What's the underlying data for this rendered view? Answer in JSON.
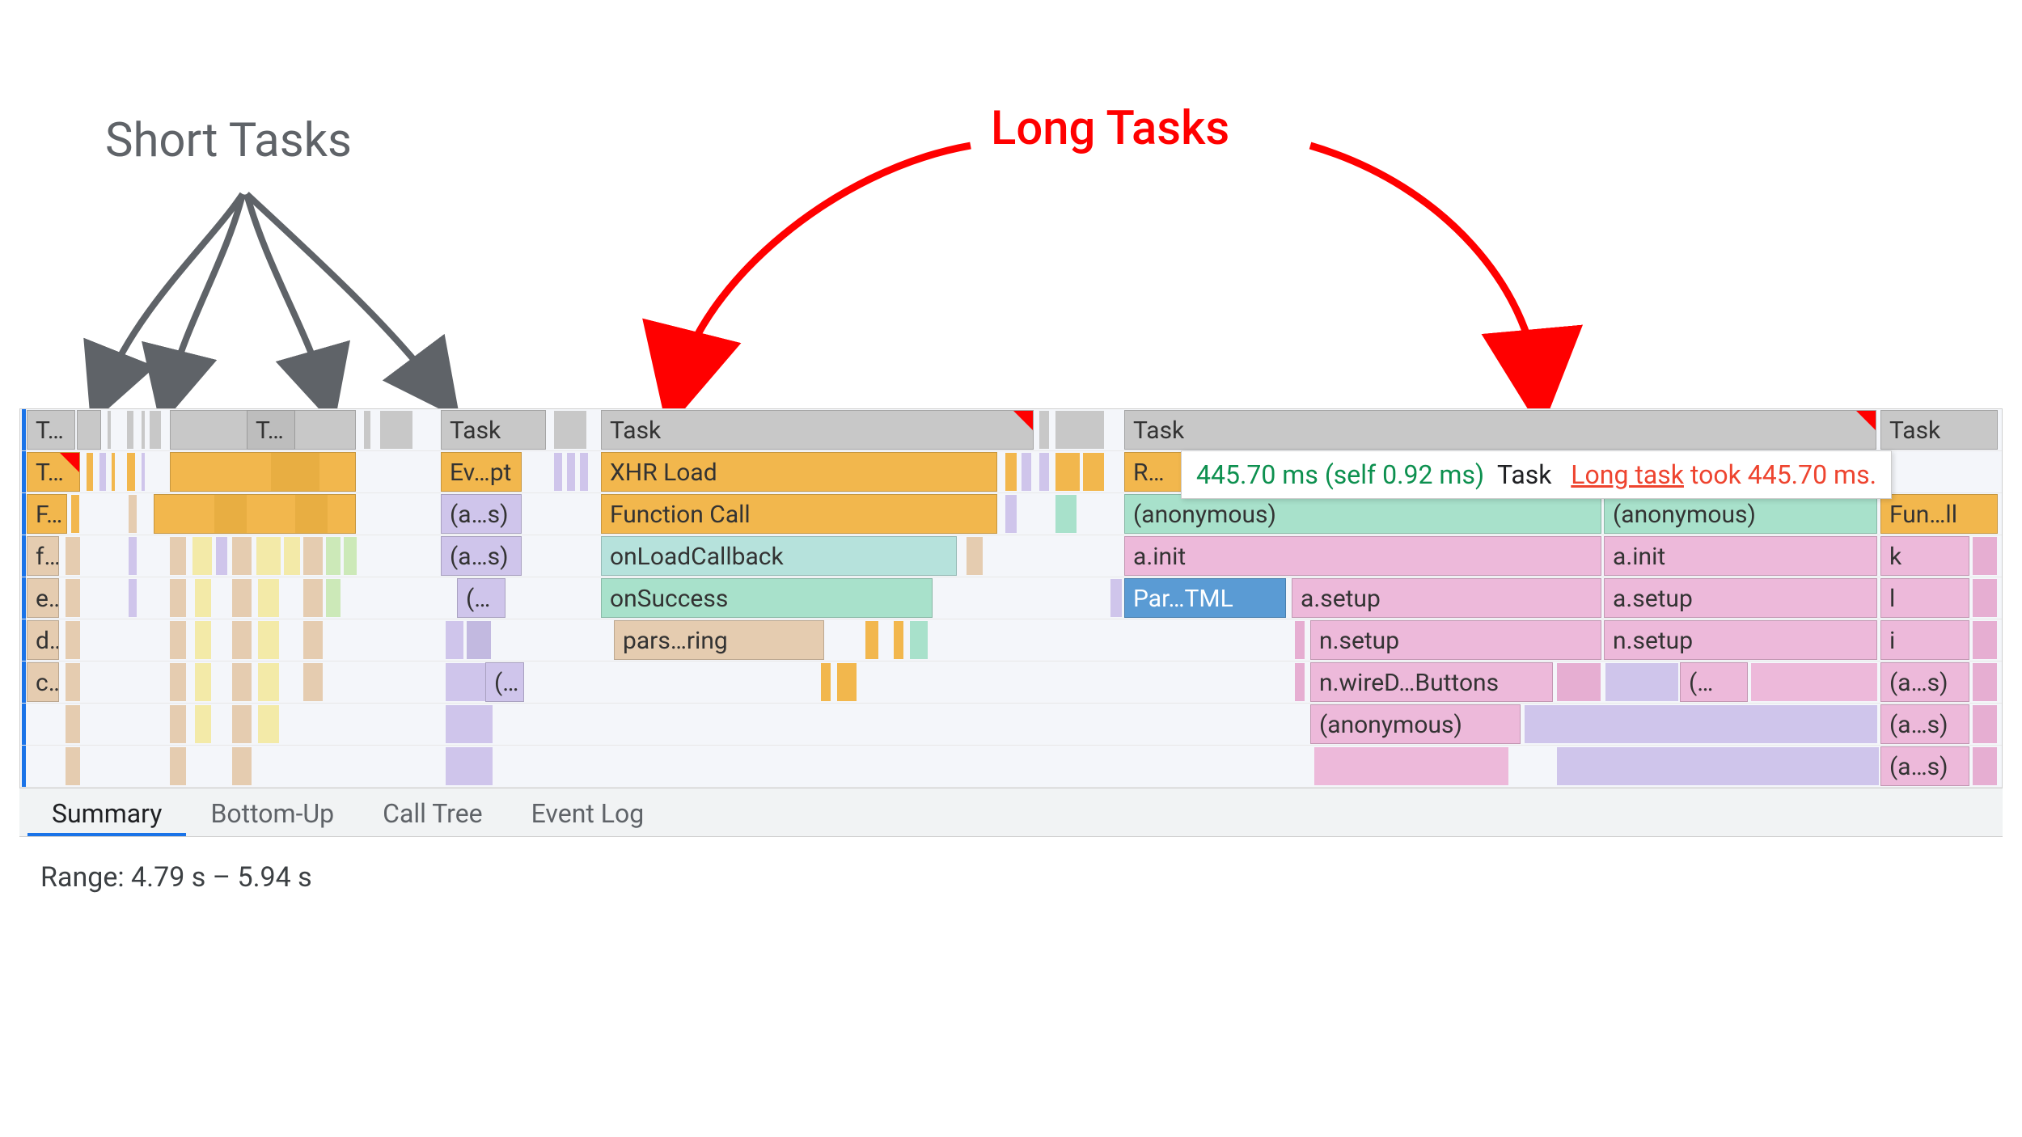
{
  "annotations": {
    "short_label": "Short Tasks",
    "long_label": "Long Tasks"
  },
  "tooltip": {
    "time_self": "445.70 ms (self 0.92 ms)",
    "entity": "Task",
    "link": "Long task",
    "took": "took 445.70 ms."
  },
  "flame": {
    "row0_a": "T…k",
    "row0_b": "T…",
    "row0_task_a": "Task",
    "row0_task_b": "Task",
    "row0_task_c": "Task",
    "row0_task_d": "Task",
    "row1_a": "T…d",
    "row1_ev": "Ev…pt",
    "row1_xhr": "XHR Load",
    "row1_run": "Run",
    "row2_fl": "F…l",
    "row2_as": "(a…s)",
    "row2_fn": "Function Call",
    "row2_anon1": "(anonymous)",
    "row2_anon2": "(anonymous)",
    "row2_fun": "Fun…ll",
    "row3_ff": "ff",
    "row3_as": "(a…s)",
    "row3_onload": "onLoadCallback",
    "row3_ainit1": "a.init",
    "row3_ainit2": "a.init",
    "row3_k": "k",
    "row4_ef": "ef",
    "row4_paren": "(…)",
    "row4_onsucc": "onSuccess",
    "row4_parse": "Par…TML",
    "row4_asetup1": "a.setup",
    "row4_asetup2": "a.setup",
    "row4_l": "l",
    "row5_df": "df",
    "row5_pars": "pars…ring",
    "row5_nsetup1": "n.setup",
    "row5_nsetup2": "n.setup",
    "row5_i": "i",
    "row6_cf": "cf",
    "row6_paren": "(…",
    "row6_wire": "n.wireD…Buttons",
    "row6_paren2": "(…",
    "row6_as": "(a…s)",
    "row7_anon": "(anonymous)",
    "row7_as": "(a…s)",
    "row8_as": "(a…s)"
  },
  "tabs": {
    "summary": "Summary",
    "bottomup": "Bottom-Up",
    "calltree": "Call Tree",
    "eventlog": "Event Log"
  },
  "range": "Range:  4.79 s – 5.94 s"
}
